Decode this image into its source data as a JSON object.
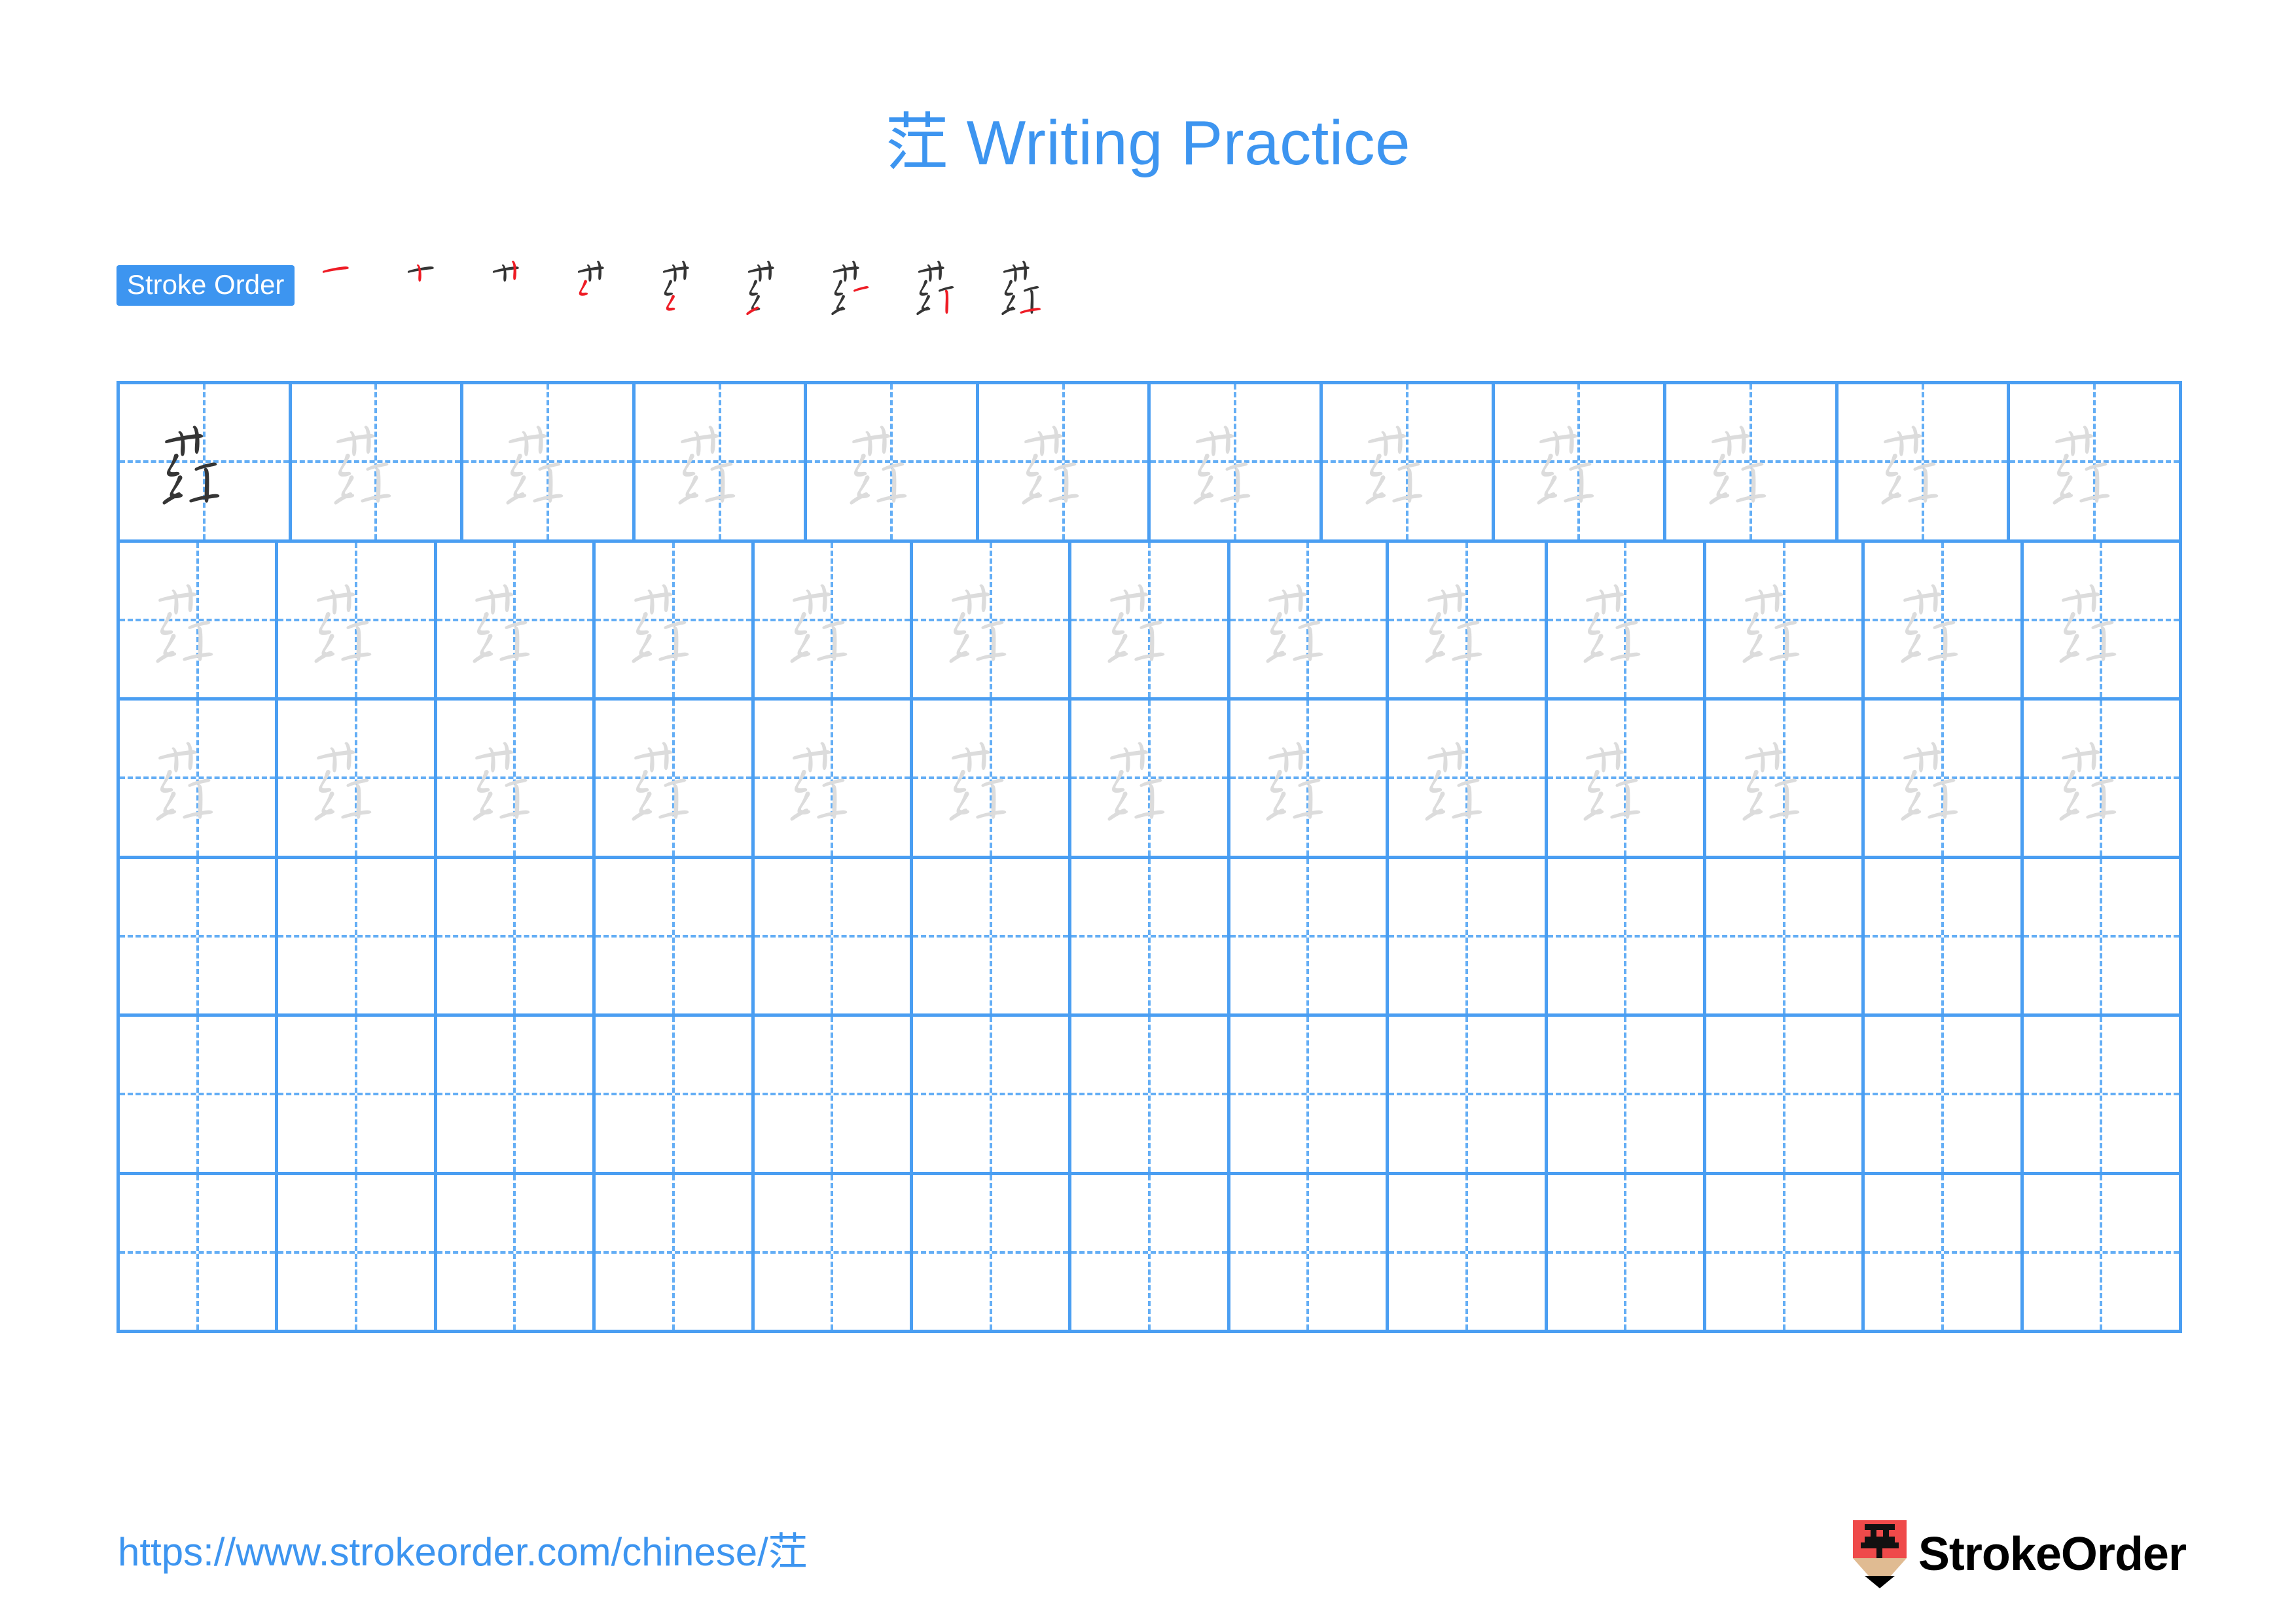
{
  "page": {
    "character": "茳",
    "title_suffix": " Writing Practice",
    "title_full": "茳 Writing Practice",
    "background_color": "#ffffff",
    "accent_color": "#3d95f0",
    "grid_line_color": "#4a9ef2",
    "grid_guide_color": "#64aef5",
    "model_glyph_color": "#353535",
    "trace_glyph_color": "#dcdcdc",
    "new_stroke_color": "#ee1c25"
  },
  "stroke_order": {
    "badge_label": "Stroke Order",
    "total_strokes": 9,
    "steps": [
      {
        "index": 1,
        "strokes_shown": 1,
        "new_stroke": "héng"
      },
      {
        "index": 2,
        "strokes_shown": 2,
        "new_stroke": "shù"
      },
      {
        "index": 3,
        "strokes_shown": 3,
        "new_stroke": "shù"
      },
      {
        "index": 4,
        "strokes_shown": 4,
        "new_stroke": "piě-zhé"
      },
      {
        "index": 5,
        "strokes_shown": 5,
        "new_stroke": "piě-zhé"
      },
      {
        "index": 6,
        "strokes_shown": 6,
        "new_stroke": "tí"
      },
      {
        "index": 7,
        "strokes_shown": 7,
        "new_stroke": "héng"
      },
      {
        "index": 8,
        "strokes_shown": 8,
        "new_stroke": "shù"
      },
      {
        "index": 9,
        "strokes_shown": 9,
        "new_stroke": "héng"
      }
    ]
  },
  "practice_grid": {
    "columns": 13,
    "rows": 6,
    "row_types": [
      "model-then-trace",
      "trace",
      "trace",
      "blank",
      "blank",
      "blank"
    ],
    "model_cell": {
      "row": 1,
      "column": 1,
      "character": "茳"
    },
    "trace_character": "茳",
    "trace_rows": [
      1,
      2,
      3
    ],
    "blank_rows": [
      4,
      5,
      6
    ]
  },
  "footer": {
    "url_text": "https://www.strokeorder.com/chinese/",
    "url_char": "茳",
    "url_full": "https://www.strokeorder.com/chinese/茳",
    "brand_name": "StrokeOrder",
    "brand_mark_char": "字",
    "brand_mark_body_color": "#ef4a4a",
    "brand_mark_tip_color": "#e0bb92"
  }
}
